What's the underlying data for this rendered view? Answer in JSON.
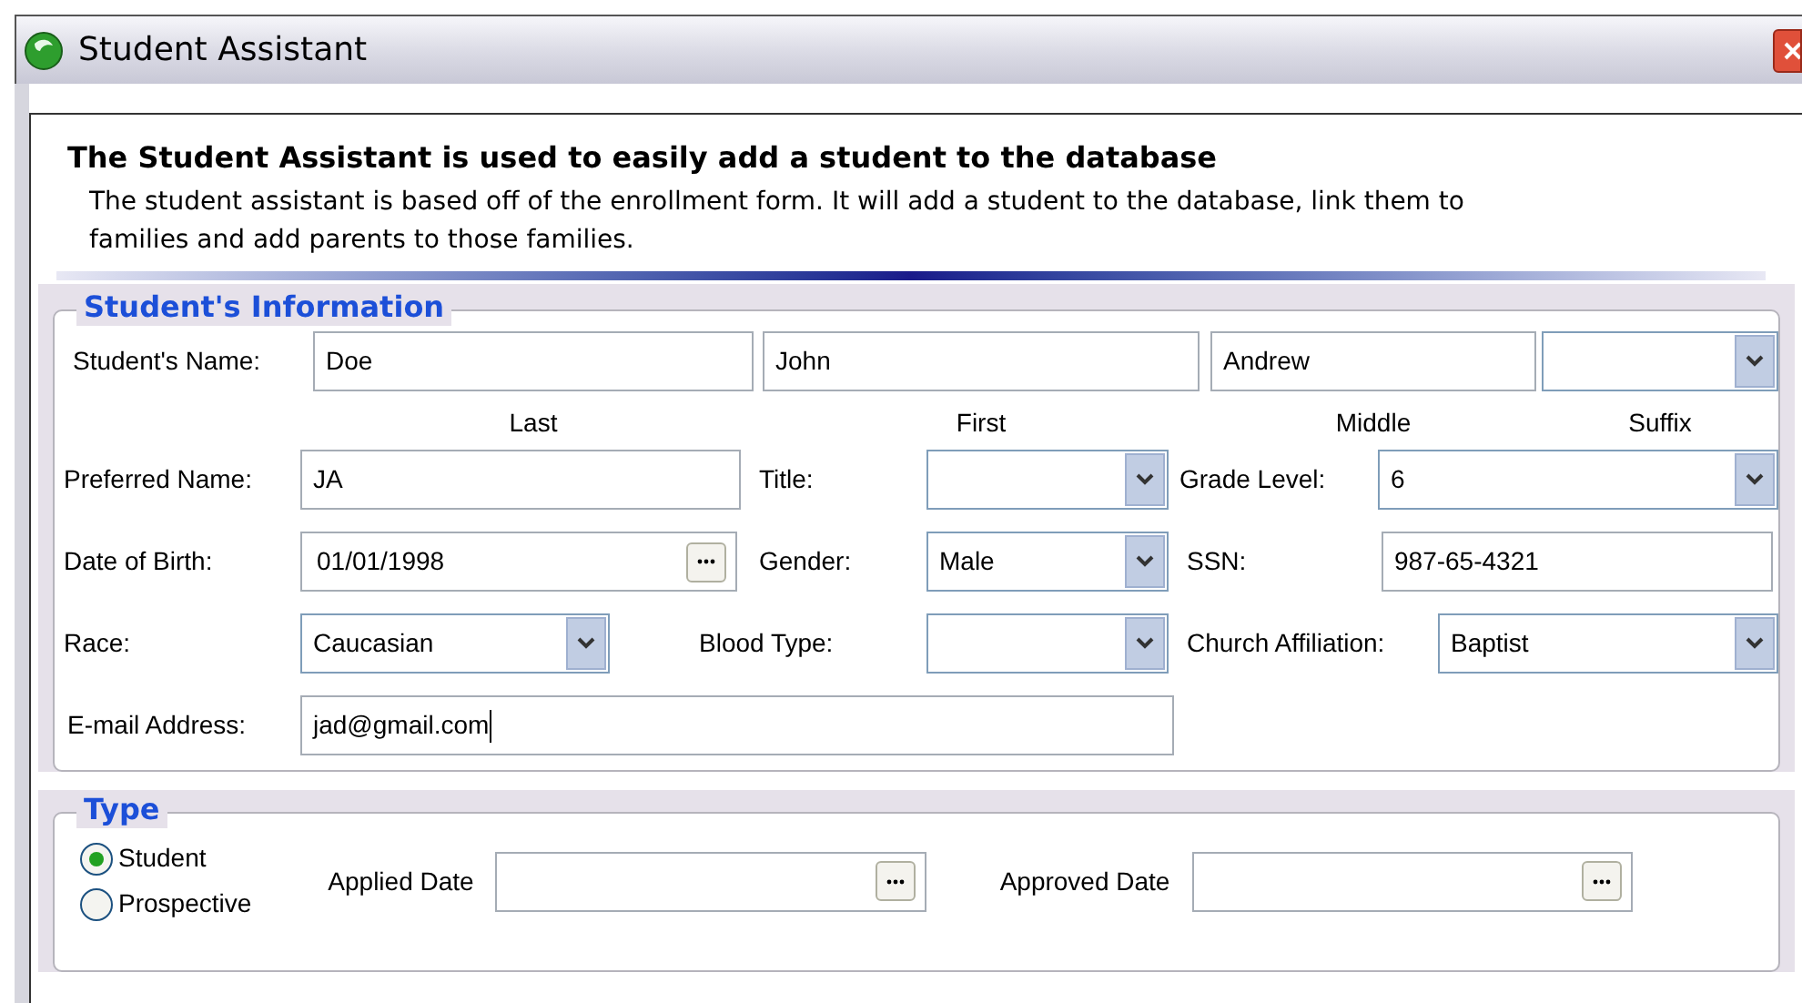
{
  "window": {
    "title": "Student Assistant"
  },
  "header": {
    "heading": "The Student Assistant is used to easily add a student to the database",
    "description": "The student assistant is based off of the enrollment form. It will add a student to the database, link them to families and add parents to those families."
  },
  "student_info": {
    "title": "Student's Information",
    "name_label": "Student's Name:",
    "name_parts": [
      {
        "kind": "text",
        "value": "Doe",
        "caption": "Last"
      },
      {
        "kind": "text",
        "value": "John",
        "caption": "First"
      },
      {
        "kind": "text",
        "value": "Andrew",
        "caption": "Middle"
      },
      {
        "kind": "combo",
        "caption": "Suffix"
      }
    ],
    "fields": [
      {
        "label": "Preferred Name:",
        "kind": "text",
        "value": "JA",
        "focused": false
      },
      {
        "label": "Title:",
        "kind": "combo",
        "focused": false
      },
      {
        "label": "Grade Level:",
        "kind": "combo",
        "value": "6",
        "focused": false
      },
      {
        "label": "Date of Birth:",
        "kind": "date",
        "value": "01/01/1998",
        "focused": false
      },
      {
        "label": "Gender:",
        "kind": "combo",
        "value": "Male",
        "focused": false
      },
      {
        "label": "SSN:",
        "kind": "text",
        "value": "987-65-4321",
        "focused": false
      },
      {
        "label": "Race:",
        "kind": "combo",
        "value": "Caucasian",
        "focused": false
      },
      {
        "label": "Blood Type:",
        "kind": "combo",
        "focused": false
      },
      {
        "label": "Church Affiliation:",
        "kind": "combo",
        "value": "Baptist",
        "focused": false
      },
      {
        "label": "E-mail Address:",
        "kind": "text",
        "value": "jad@gmail.com",
        "focused": true
      }
    ]
  },
  "type": {
    "title": "Type",
    "options": [
      {
        "label": "Student",
        "selected": true
      },
      {
        "label": "Prospective",
        "selected": false
      }
    ],
    "dates": [
      {
        "label": "Applied Date",
        "kind": "date"
      },
      {
        "label": "Approved Date",
        "kind": "date"
      }
    ]
  }
}
